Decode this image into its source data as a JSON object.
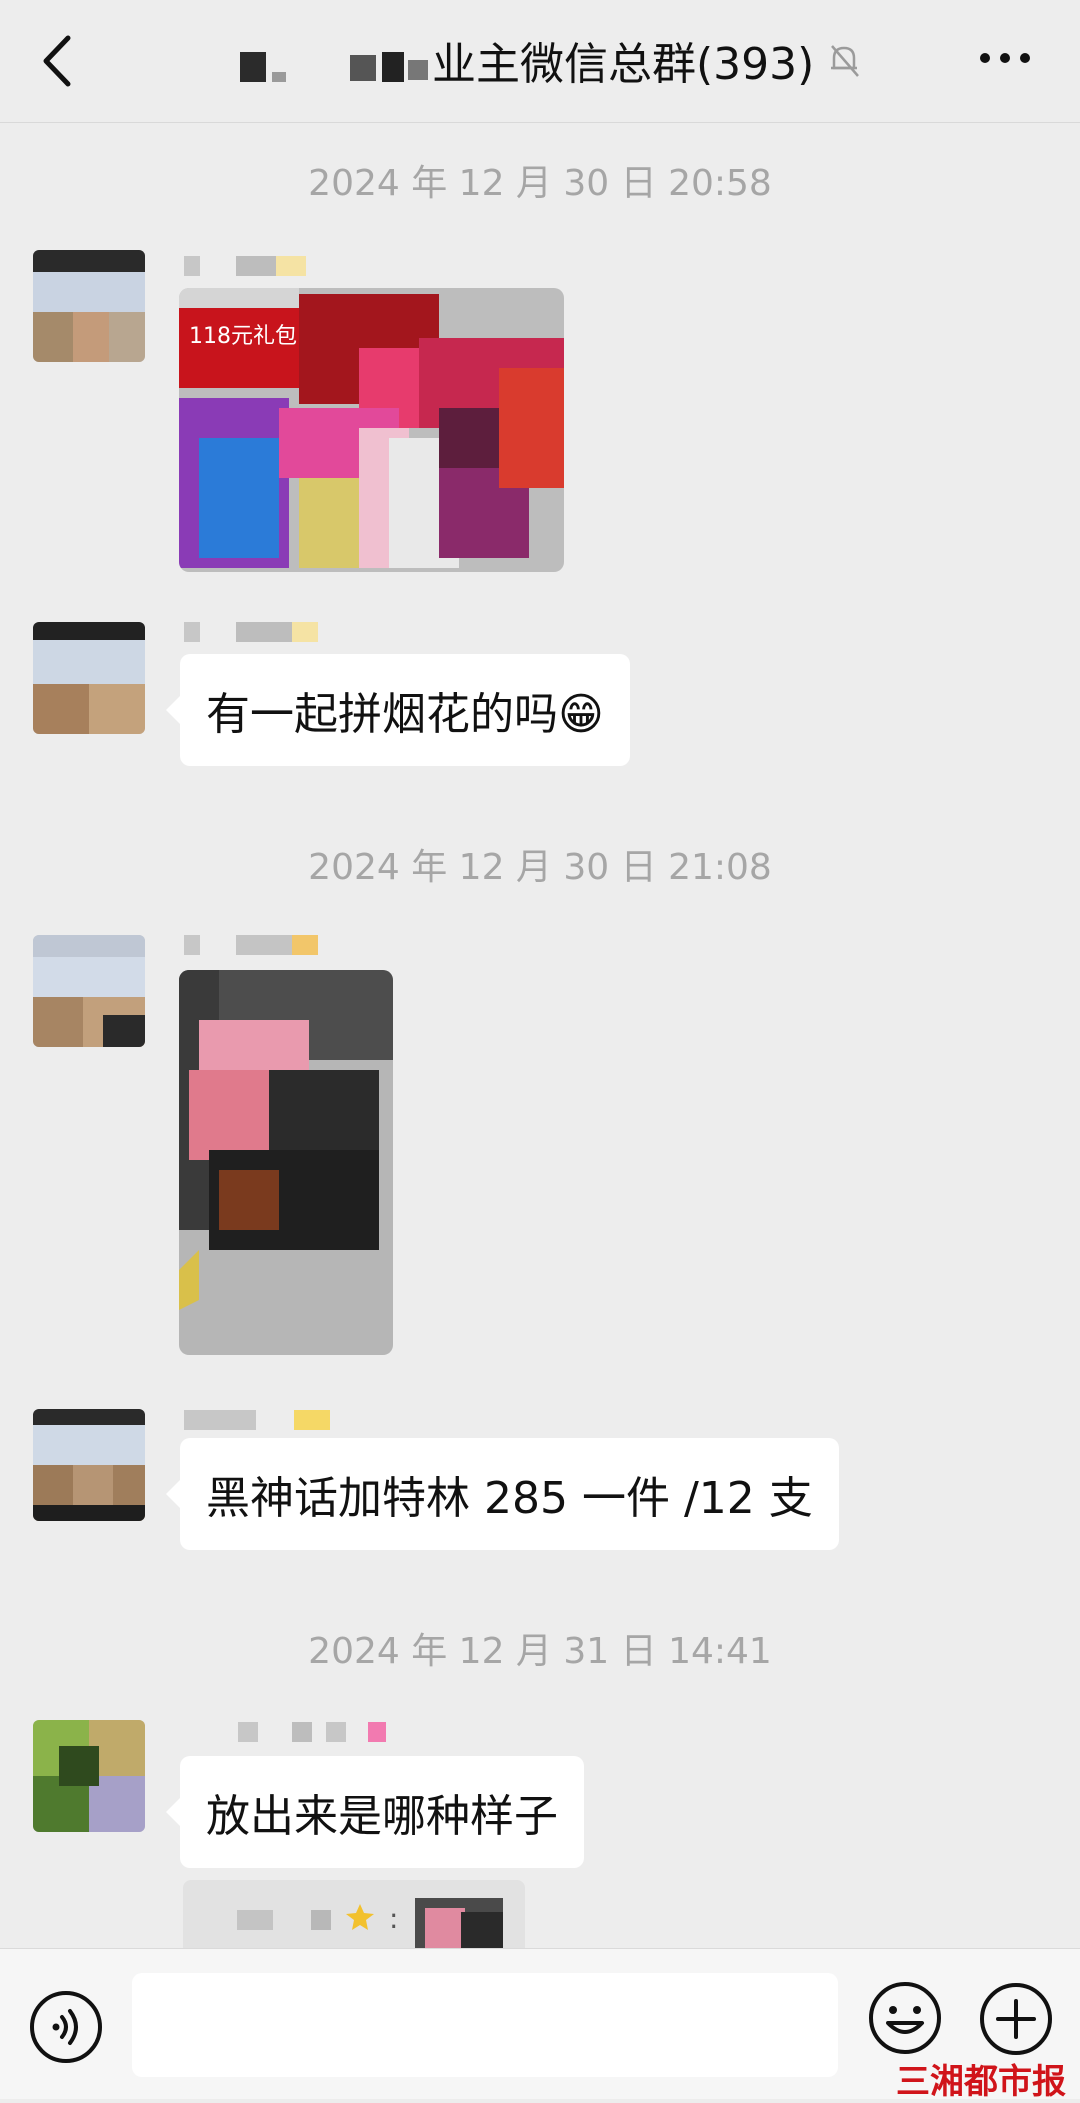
{
  "header": {
    "title": "业主微信总群(393)",
    "back_icon": "chevron-left-icon",
    "mute_icon": "bell-off-icon",
    "more_icon": "more-dots-icon"
  },
  "messages": [
    {
      "timestamp": "2024 年 12 月 30 日 20:58"
    },
    {
      "type": "image",
      "image_label": "118元礼包"
    },
    {
      "type": "text",
      "text": "有一起拼烟花的吗😁"
    },
    {
      "timestamp": "2024 年 12 月 30 日 21:08"
    },
    {
      "type": "image"
    },
    {
      "type": "text",
      "text": "黑神话加特林 285 一件 /12 支"
    },
    {
      "timestamp": "2024 年 12 月 31 日 14:41"
    },
    {
      "type": "text",
      "text": "放出来是哪种样子"
    },
    {
      "type": "quote",
      "separator": ":"
    }
  ],
  "input_bar": {
    "voice_icon": "voice-icon",
    "emoji_icon": "emoji-icon",
    "plus_icon": "plus-icon",
    "placeholder": ""
  },
  "watermark": "三湘都市报",
  "colors": {
    "background": "#ededed",
    "bubble": "#ffffff",
    "timestamp": "#a6a6a6",
    "watermark": "#d0141a"
  }
}
